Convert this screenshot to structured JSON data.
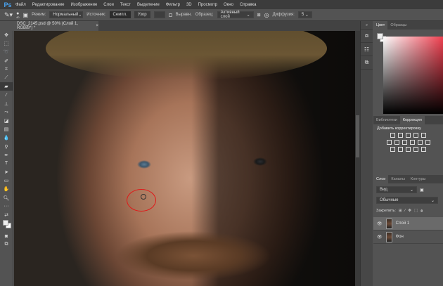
{
  "menu": {
    "logo": "Ps",
    "items": [
      "Файл",
      "Редактирование",
      "Изображение",
      "Слои",
      "Текст",
      "Выделение",
      "Фильтр",
      "3D",
      "Просмотр",
      "Окно",
      "Справка"
    ]
  },
  "options": {
    "brush_size": "40",
    "mode_label": "Режим:",
    "mode_value": "Нормальный",
    "source_label": "Источник:",
    "source_sampled": "Семпл.",
    "source_pattern": "Узор",
    "aligned_label": "Выравн.",
    "sample_label": "Образец:",
    "sample_value": "Активный слой",
    "diffusion_label": "Диффузия:",
    "diffusion_value": "5"
  },
  "document": {
    "tab_title": "DSC_2145.psd @ 50% (Слой 1, RGB/8*) *",
    "close": "×"
  },
  "tools": [
    "move",
    "marquee",
    "lasso",
    "quick-select",
    "crop",
    "eyedropper",
    "healing-brush",
    "brush",
    "clone-stamp",
    "history-brush",
    "eraser",
    "gradient",
    "blur",
    "dodge",
    "pen",
    "type",
    "path-select",
    "rectangle",
    "hand",
    "zoom",
    "more",
    "swap-colors",
    "colors",
    "quick-mask",
    "screen-mode"
  ],
  "panels": {
    "color_tabs": [
      "Цвет",
      "Образцы"
    ],
    "adj_tabs": [
      "Библиотеки",
      "Коррекция"
    ],
    "adj_title": "Добавить корректировку",
    "layers_tabs": [
      "Слои",
      "Каналы",
      "Контуры"
    ],
    "filter_kind": "Вид",
    "blend_mode": "Обычные",
    "lock_label": "Закрепить:",
    "layers": [
      {
        "name": "Слой 1",
        "selected": true
      },
      {
        "name": "Фон",
        "selected": false
      }
    ]
  },
  "colors": {
    "accent": "#4aa3f0",
    "highlight_circle": "#e01818"
  }
}
